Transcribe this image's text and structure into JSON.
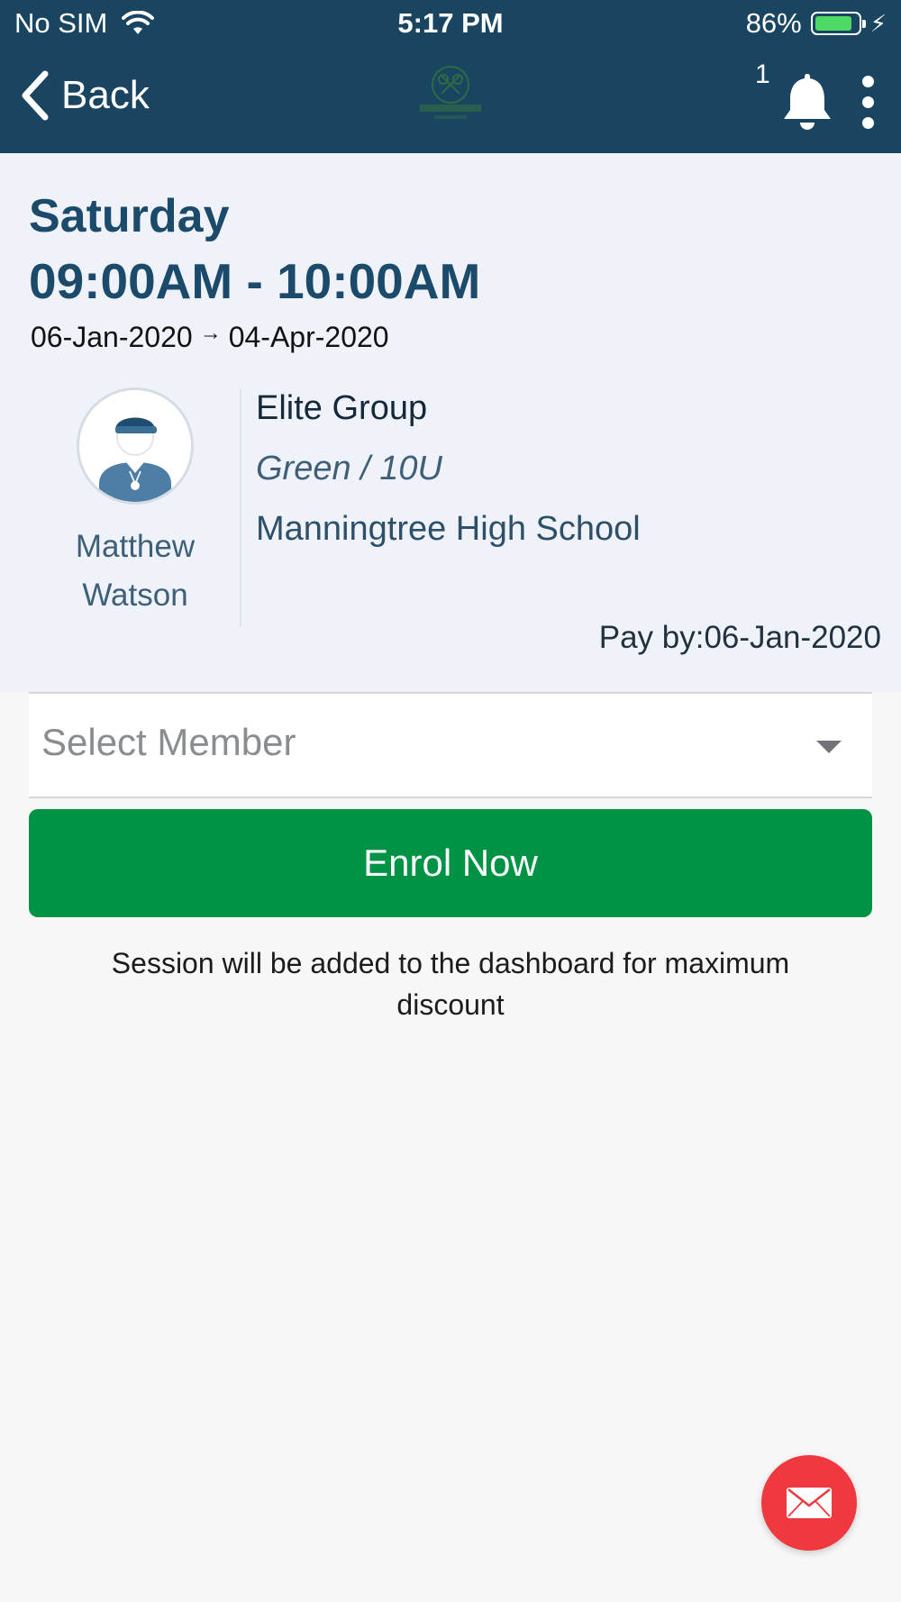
{
  "status_bar": {
    "carrier": "No SIM",
    "time": "5:17 PM",
    "battery_percent": "86%",
    "battery_level": 0.86,
    "battery_color": "#4cd964"
  },
  "nav": {
    "back_label": "Back",
    "notification_count": "1",
    "logo_text": "MATTHEW WATSON",
    "icons": [
      "chevron-left-icon",
      "bell-icon",
      "more-vertical-icon"
    ]
  },
  "session": {
    "day": "Saturday",
    "time_range": "09:00AM - 10:00AM",
    "start_date": "06-Jan-2020",
    "end_date": "04-Apr-2020",
    "arrow": "→",
    "coach_first_name": "Matthew",
    "coach_last_name": "Watson",
    "group_name": "Elite Group",
    "level": "Green / 10U",
    "venue": "Manningtree High School",
    "pay_by": "Pay by:06-Jan-2020"
  },
  "form": {
    "member_select_placeholder": "Select Member",
    "enrol_label": "Enrol Now",
    "note": "Session will be added to the dashboard for maximum discount"
  },
  "colors": {
    "header_bg": "#1a4560",
    "card_bg": "#eff3f9",
    "accent_text": "#1b4a6b",
    "enrol_button": "#009245",
    "fab": "#f0393e"
  }
}
